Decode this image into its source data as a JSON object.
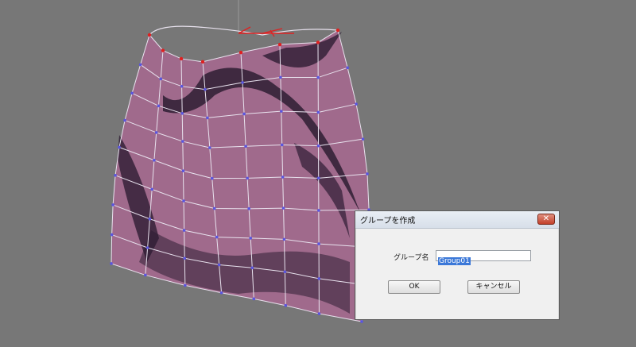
{
  "viewport": {
    "background_color": "#777777",
    "mesh": {
      "fill_color": "#a06a8c",
      "dark_band_color": "#2e1d33",
      "wire_color": "#e8e2ee",
      "vertex_color": "#5a55e0",
      "selected_vertex_color": "#e02020"
    },
    "gizmo_color": "#e02020"
  },
  "dialog": {
    "title": "グループを作成",
    "close_symbol": "✕",
    "name_label": "グループ名",
    "name_value": "Group01",
    "ok_label": "OK",
    "cancel_label": "キャンセル"
  }
}
